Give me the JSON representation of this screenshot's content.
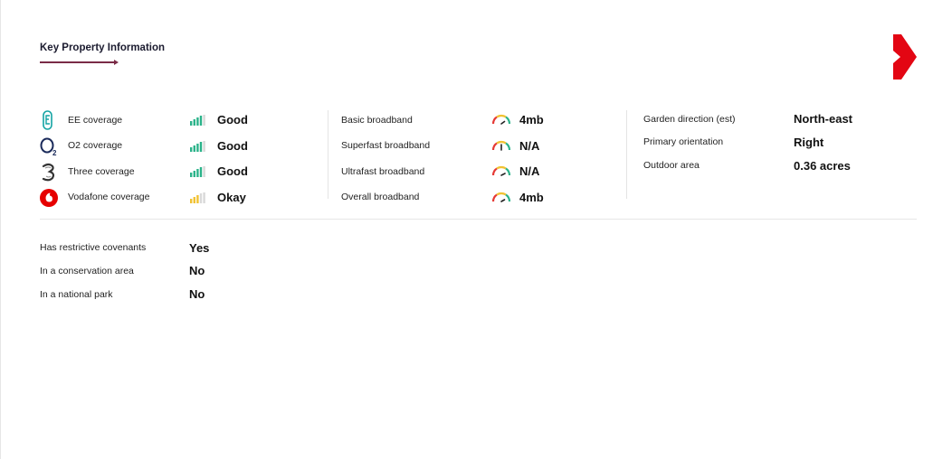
{
  "section": {
    "title": "Key Property Information"
  },
  "mobile": [
    {
      "network": "EE",
      "label": "EE coverage",
      "status": "Good",
      "signal_level": 4,
      "icon": "ee-logo-icon"
    },
    {
      "network": "O2",
      "label": "O2 coverage",
      "status": "Good",
      "signal_level": 4,
      "icon": "o2-logo-icon"
    },
    {
      "network": "Three",
      "label": "Three coverage",
      "status": "Good",
      "signal_level": 4,
      "icon": "three-logo-icon"
    },
    {
      "network": "Vodafone",
      "label": "Vodafone coverage",
      "status": "Okay",
      "signal_level": 3,
      "icon": "vodafone-logo-icon"
    }
  ],
  "broadband": [
    {
      "label": "Basic broadband",
      "value": "4mb",
      "icon": "speed-gauge-icon"
    },
    {
      "label": "Superfast broadband",
      "value": "N/A",
      "icon": "speed-gauge-icon"
    },
    {
      "label": "Ultrafast broadband",
      "value": "N/A",
      "icon": "speed-gauge-icon"
    },
    {
      "label": "Overall broadband",
      "value": "4mb",
      "icon": "speed-gauge-icon"
    }
  ],
  "garden": [
    {
      "label": "Garden direction (est)",
      "value": "North-east"
    },
    {
      "label": "Primary orientation",
      "value": "Right"
    },
    {
      "label": "Outdoor area",
      "value": "0.36 acres"
    }
  ],
  "restrictions": [
    {
      "label": "Has restrictive covenants",
      "value": "Yes"
    },
    {
      "label": "In a conservation area",
      "value": "No"
    },
    {
      "label": "In a national park",
      "value": "No"
    }
  ],
  "colors": {
    "signal_good": "#2bb38a",
    "signal_okay": "#f1c232",
    "signal_empty": "#d9d9d9",
    "brand_red": "#e30613",
    "ee_teal": "#13a3a3",
    "vodafone_red": "#e60000",
    "accent_line": "#7a2b47"
  }
}
